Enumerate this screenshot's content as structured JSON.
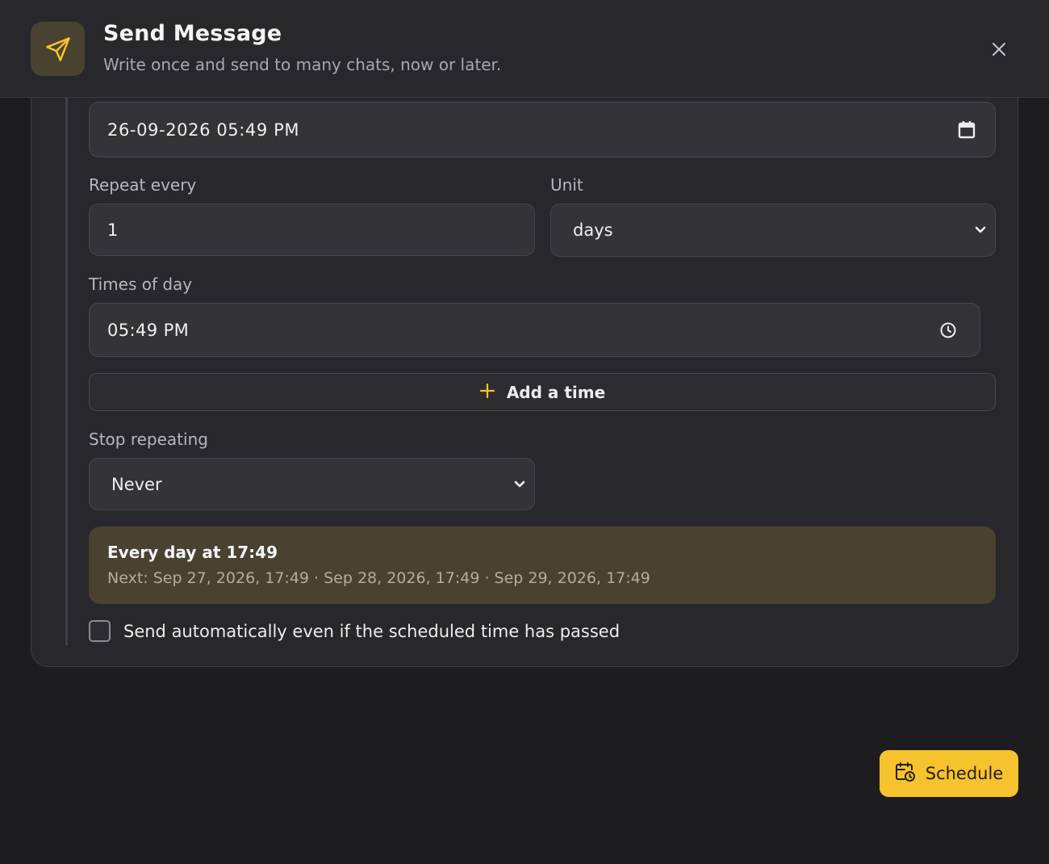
{
  "header": {
    "title": "Send Message",
    "subtitle": "Write once and send to many chats, now or later.",
    "icon": "send-icon"
  },
  "form": {
    "datetime_value": "26-09-2026 05:49 PM",
    "repeat_label": "Repeat every",
    "repeat_value": "1",
    "unit_label": "Unit",
    "unit_value": "days",
    "times_label": "Times of day",
    "time_value": "05:49 PM",
    "add_time_label": "Add a time",
    "stop_label": "Stop repeating",
    "stop_value": "Never",
    "summary_title": "Every day at 17:49",
    "summary_next": "Next: Sep 27, 2026, 17:49 · Sep 28, 2026, 17:49 · Sep 29, 2026, 17:49",
    "auto_send_label": "Send automatically even if the scheduled time has passed",
    "auto_send_checked": false
  },
  "footer": {
    "schedule_label": "Schedule"
  },
  "colors": {
    "accent": "#f6c22d",
    "background": "#1d1d20",
    "panel": "#28282c",
    "summary_bg": "#4a4231"
  }
}
